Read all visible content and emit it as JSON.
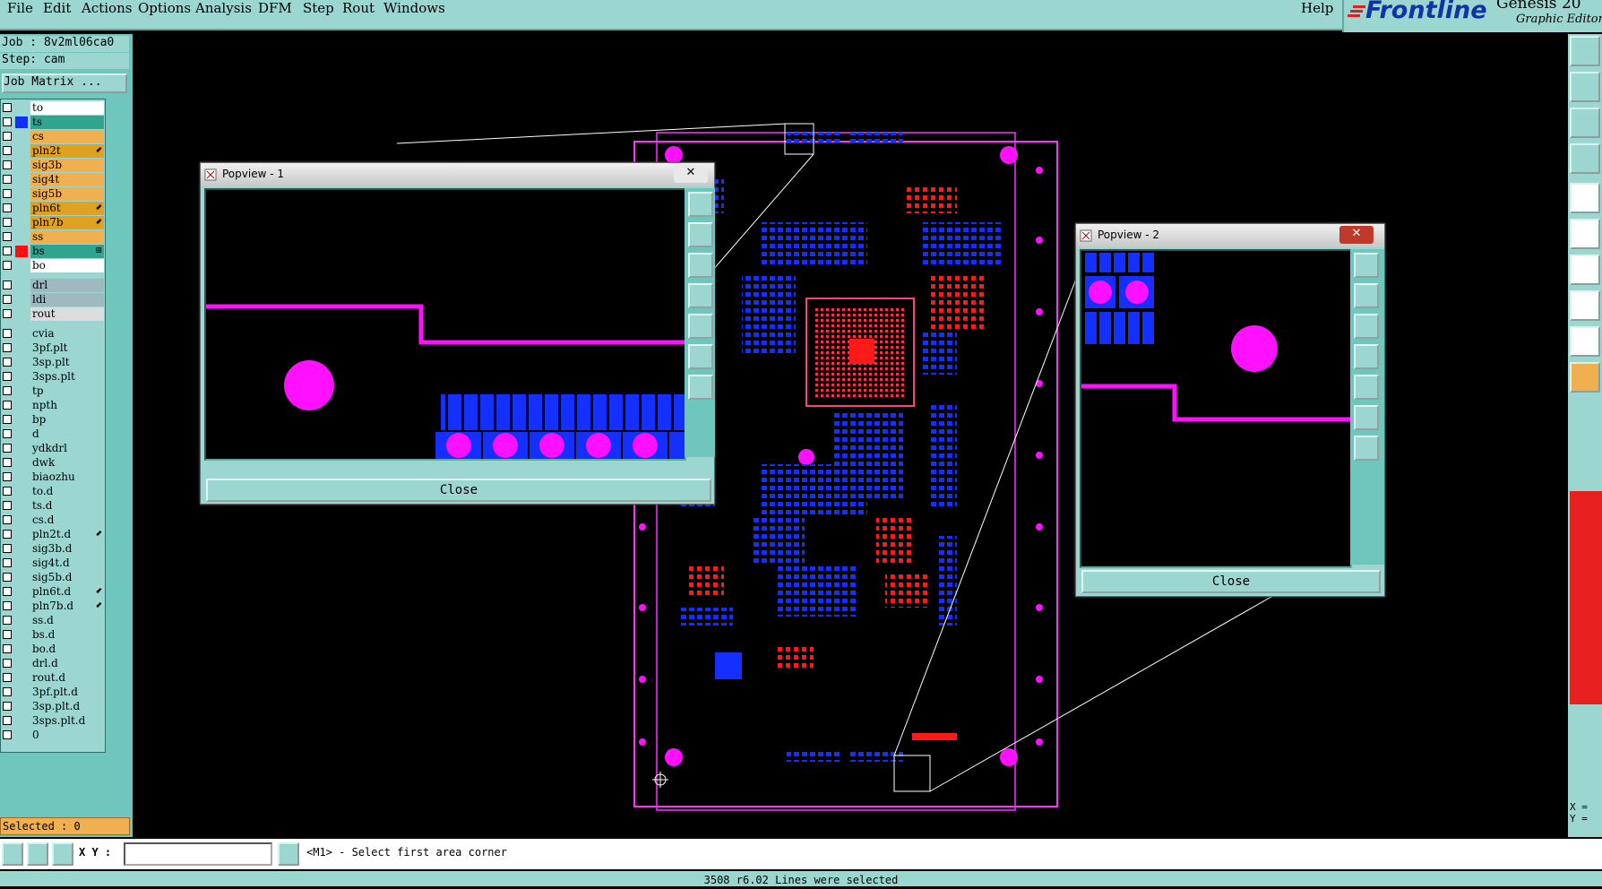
{
  "menu": {
    "items": [
      "File",
      "Edit",
      "Actions",
      "Options",
      "Analysis",
      "DFM",
      "Step",
      "Rout",
      "Windows"
    ],
    "help": "Help"
  },
  "brand": {
    "logo": "Frontline",
    "product": "Genesis 20",
    "subtitle": "Graphic Editor"
  },
  "job": {
    "job_line": "Job : 8v2ml06ca0",
    "step_line": "Step: cam",
    "job_matrix": "Job Matrix ..."
  },
  "layers": [
    {
      "name": "to",
      "color": "#ffffff",
      "swatch": "",
      "arrow": ""
    },
    {
      "name": "ts",
      "color": "#2fa58f",
      "swatch": "#1030ff",
      "arrow": ""
    },
    {
      "name": "cs",
      "color": "#f0b050",
      "swatch": "",
      "arrow": ""
    },
    {
      "name": "pln2t",
      "color": "#e0a020",
      "swatch": "",
      "arrow": "⬋"
    },
    {
      "name": "sig3b",
      "color": "#f0b050",
      "swatch": "",
      "arrow": ""
    },
    {
      "name": "sig4t",
      "color": "#f0b050",
      "swatch": "",
      "arrow": ""
    },
    {
      "name": "sig5b",
      "color": "#f0b050",
      "swatch": "",
      "arrow": ""
    },
    {
      "name": "pln6t",
      "color": "#e0a020",
      "swatch": "",
      "arrow": "⬋"
    },
    {
      "name": "pln7b",
      "color": "#e0a020",
      "swatch": "",
      "arrow": "⬋"
    },
    {
      "name": "ss",
      "color": "#f0b050",
      "swatch": "",
      "arrow": ""
    },
    {
      "name": "bs",
      "color": "#2fa58f",
      "swatch": "#ff1010",
      "arrow": "⊞"
    },
    {
      "name": "bo",
      "color": "#ffffff",
      "swatch": "",
      "arrow": ""
    },
    {
      "name": "drl",
      "color": "#a0b8c0",
      "swatch": "",
      "arrow": ""
    },
    {
      "name": "ldi",
      "color": "#a0b8c0",
      "swatch": "",
      "arrow": ""
    },
    {
      "name": "rout",
      "color": "#dcdcdc",
      "swatch": "",
      "arrow": ""
    },
    {
      "name": "cvia",
      "color": "#9bd6d0",
      "swatch": "",
      "arrow": ""
    },
    {
      "name": "3pf.plt",
      "color": "#9bd6d0",
      "swatch": "",
      "arrow": ""
    },
    {
      "name": "3sp.plt",
      "color": "#9bd6d0",
      "swatch": "",
      "arrow": ""
    },
    {
      "name": "3sps.plt",
      "color": "#9bd6d0",
      "swatch": "",
      "arrow": ""
    },
    {
      "name": "tp",
      "color": "#9bd6d0",
      "swatch": "",
      "arrow": ""
    },
    {
      "name": "npth",
      "color": "#9bd6d0",
      "swatch": "",
      "arrow": ""
    },
    {
      "name": "bp",
      "color": "#9bd6d0",
      "swatch": "",
      "arrow": ""
    },
    {
      "name": "d",
      "color": "#9bd6d0",
      "swatch": "",
      "arrow": ""
    },
    {
      "name": "ydkdrl",
      "color": "#9bd6d0",
      "swatch": "",
      "arrow": ""
    },
    {
      "name": "dwk",
      "color": "#9bd6d0",
      "swatch": "",
      "arrow": ""
    },
    {
      "name": "biaozhu",
      "color": "#9bd6d0",
      "swatch": "",
      "arrow": ""
    },
    {
      "name": "to.d",
      "color": "#9bd6d0",
      "swatch": "",
      "arrow": ""
    },
    {
      "name": "ts.d",
      "color": "#9bd6d0",
      "swatch": "",
      "arrow": ""
    },
    {
      "name": "cs.d",
      "color": "#9bd6d0",
      "swatch": "",
      "arrow": ""
    },
    {
      "name": "pln2t.d",
      "color": "#9bd6d0",
      "swatch": "",
      "arrow": "⬋"
    },
    {
      "name": "sig3b.d",
      "color": "#9bd6d0",
      "swatch": "",
      "arrow": ""
    },
    {
      "name": "sig4t.d",
      "color": "#9bd6d0",
      "swatch": "",
      "arrow": ""
    },
    {
      "name": "sig5b.d",
      "color": "#9bd6d0",
      "swatch": "",
      "arrow": ""
    },
    {
      "name": "pln6t.d",
      "color": "#9bd6d0",
      "swatch": "",
      "arrow": "⬋"
    },
    {
      "name": "pln7b.d",
      "color": "#9bd6d0",
      "swatch": "",
      "arrow": "⬋"
    },
    {
      "name": "ss.d",
      "color": "#9bd6d0",
      "swatch": "",
      "arrow": ""
    },
    {
      "name": "bs.d",
      "color": "#9bd6d0",
      "swatch": "",
      "arrow": ""
    },
    {
      "name": "bo.d",
      "color": "#9bd6d0",
      "swatch": "",
      "arrow": ""
    },
    {
      "name": "drl.d",
      "color": "#9bd6d0",
      "swatch": "",
      "arrow": ""
    },
    {
      "name": "rout.d",
      "color": "#9bd6d0",
      "swatch": "",
      "arrow": ""
    },
    {
      "name": "3pf.plt.d",
      "color": "#9bd6d0",
      "swatch": "",
      "arrow": ""
    },
    {
      "name": "3sp.plt.d",
      "color": "#9bd6d0",
      "swatch": "",
      "arrow": ""
    },
    {
      "name": "3sps.plt.d",
      "color": "#9bd6d0",
      "swatch": "",
      "arrow": ""
    },
    {
      "name": "0",
      "color": "#9bd6d0",
      "swatch": "",
      "arrow": ""
    }
  ],
  "selected": "Selected : 0",
  "popview1": {
    "title": "Popview - 1",
    "close": "Close",
    "x_btn": "✕"
  },
  "popview2": {
    "title": "Popview - 2",
    "close": "Close",
    "x_btn": "✕"
  },
  "command": {
    "xy_label": "X Y :",
    "xy_value": "",
    "prompt": "<M1> - Select first area corner"
  },
  "coords": {
    "x": "X =",
    "y": "Y ="
  },
  "status": "3508 r6.02 Lines were selected",
  "colors": {
    "panel": "#9bd6d0",
    "trace": "#ff10ff",
    "pad_top": "#1020ff",
    "pad_bottom": "#ff1010",
    "canvas": "#000000"
  }
}
